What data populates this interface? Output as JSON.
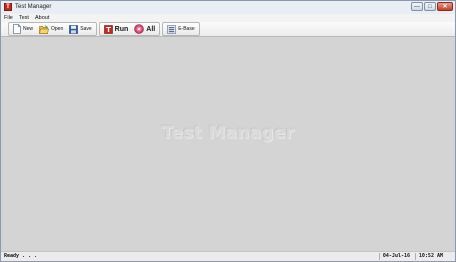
{
  "window": {
    "title": "Test Manager",
    "app_icon_glyph": "T",
    "controls": {
      "minimize": "—",
      "maximize": "□",
      "close": "✕"
    }
  },
  "menu": {
    "items": [
      {
        "label": "File"
      },
      {
        "label": "Test"
      },
      {
        "label": "About"
      }
    ]
  },
  "toolbar": {
    "new_label": "New",
    "open_label": "Open",
    "save_label": "Save",
    "run_label": "Run",
    "all_label": "All",
    "ebase_label": "E-Base",
    "run_icon_glyph": "T",
    "icons": {
      "new": "new-document-icon",
      "open": "open-folder-icon",
      "save": "floppy-disk-icon",
      "run": "run-test-icon",
      "all": "run-all-icon",
      "ebase": "database-icon"
    },
    "colors": {
      "run_red": "#c8281e",
      "all_pink": "#d9426e",
      "folder_yellow": "#f2c14e",
      "floppy_blue": "#2f5ea8"
    }
  },
  "main": {
    "watermark": "Test Manager"
  },
  "status": {
    "text": "Ready . . .",
    "date": "04-Jul-16",
    "time": "10:52 AM"
  }
}
